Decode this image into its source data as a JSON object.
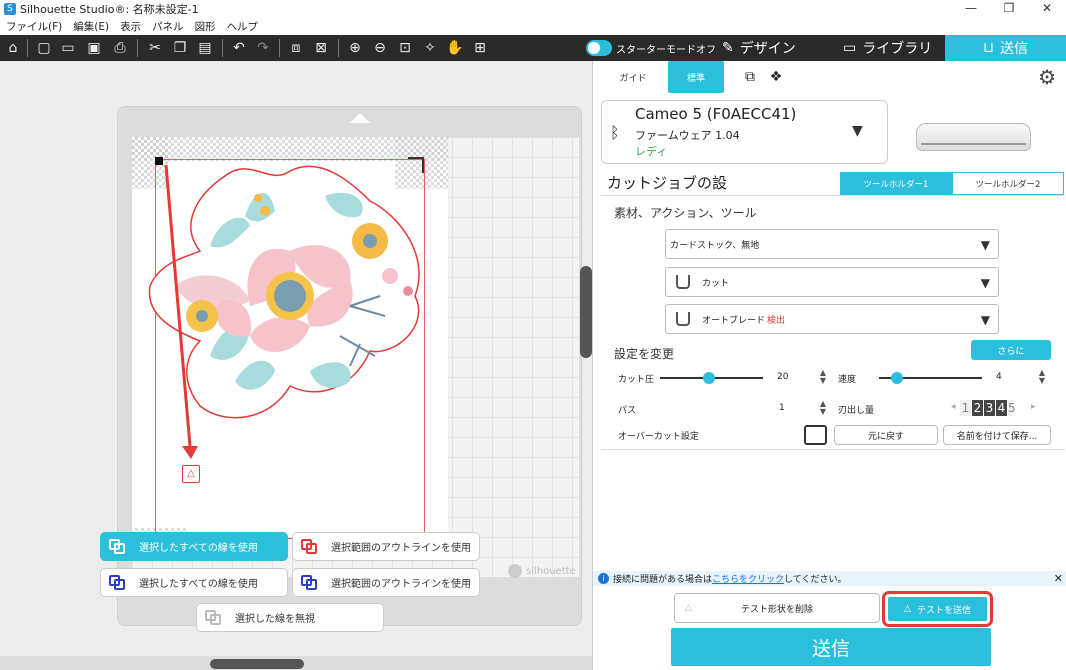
{
  "window": {
    "title": "Silhouette Studio®: 名称未設定-1",
    "controls": [
      "—",
      "❐",
      "✕"
    ]
  },
  "menu": [
    "ファイル(F)",
    "編集(E)",
    "表示",
    "パネル",
    "図形",
    "ヘルプ"
  ],
  "toolbar": {
    "starter_mode_label": "スターターモードオフ",
    "tab_design": "デザイン",
    "tab_library": "ライブラリ",
    "tab_send": "送信"
  },
  "canvas": {
    "watermark": "silhouette"
  },
  "selection_options": [
    {
      "label": "選択したすべての線を使用",
      "active": true
    },
    {
      "label": "選択範囲のアウトラインを使用",
      "active": false
    },
    {
      "label": "選択したすべての線を使用",
      "active": false
    },
    {
      "label": "選択範囲のアウトラインを使用",
      "active": false
    },
    {
      "label": "選択した線を無視",
      "active": false
    }
  ],
  "panel": {
    "mode_guide": "ガイド",
    "mode_standard": "標準",
    "device": {
      "name": "Cameo 5 (F0AECC41)",
      "firmware": "ファームウェア 1.04",
      "status": "レディ"
    },
    "cut_job_title": "カットジョブの設",
    "tool_holder_1": "ツールホルダー1",
    "tool_holder_2": "ツールホルダー2",
    "section_title": "素材、アクション、ツール",
    "material": "カードストック、無地",
    "action": "カット",
    "tool": "オートブレード",
    "tool_detected": "検出",
    "change_settings": "設定を変更",
    "more": "さらに",
    "force_label": "カット圧",
    "force_value": "20",
    "speed_label": "速度",
    "speed_value": "4",
    "passes_label": "パス",
    "passes_value": "1",
    "blade_label": "刃出し量",
    "blade_digits": [
      "1",
      "2",
      "3",
      "4",
      "5"
    ],
    "overcut_label": "オーバーカット設定",
    "revert": "元に戻す",
    "save_as": "名前を付けて保存...",
    "info_prefix": "接続に問題がある場合は",
    "info_link": "こちらをクリック",
    "info_suffix": "してください。",
    "delete_test_shape": "テスト形状を削除",
    "send_test": "テストを送信",
    "send": "送信"
  },
  "colors": {
    "accent": "#2bbfdc",
    "highlight": "#e53935",
    "toolbar_bg": "#2a2a2a"
  }
}
